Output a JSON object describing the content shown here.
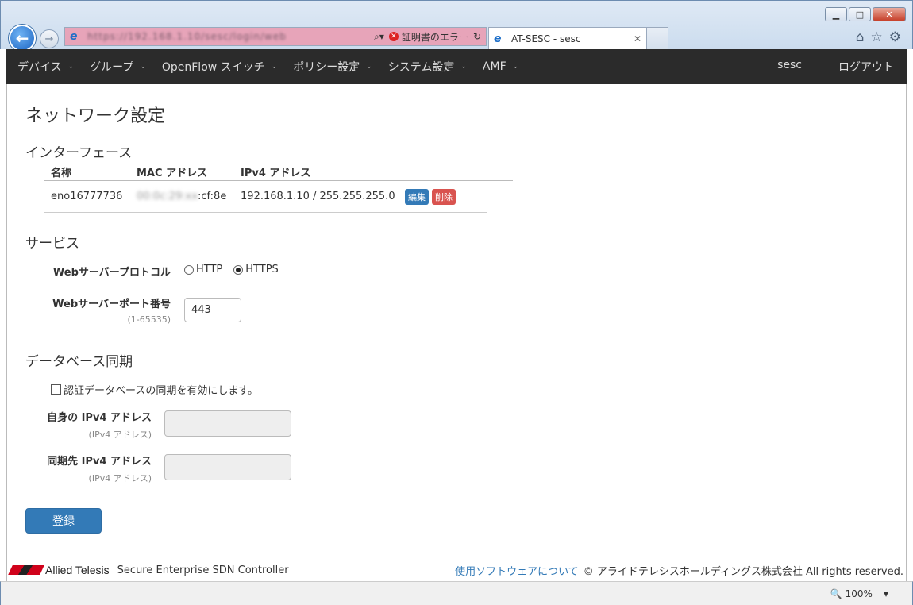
{
  "browser": {
    "address_url": "https://192.168.1.10/sesc/login/web",
    "cert_error": "証明書のエラー",
    "tab_title": "AT-SESC - sesc",
    "zoom": "100%"
  },
  "navbar": {
    "items": [
      {
        "label": "デバイス"
      },
      {
        "label": "グループ"
      },
      {
        "label": "OpenFlow スイッチ"
      },
      {
        "label": "ポリシー設定"
      },
      {
        "label": "システム設定"
      },
      {
        "label": "AMF"
      }
    ],
    "user": "sesc",
    "logout": "ログアウト"
  },
  "page": {
    "title": "ネットワーク設定",
    "interfaces": {
      "heading": "インターフェース",
      "columns": [
        "名称",
        "MAC アドレス",
        "IPv4 アドレス"
      ],
      "rows": [
        {
          "name": "eno16777736",
          "mac_hidden": "00:0c:29:xx",
          "mac_visible": ":cf:8e",
          "ipv4": "192.168.1.10 / 255.255.255.0",
          "edit": "編集",
          "delete": "削除"
        }
      ]
    },
    "services": {
      "heading": "サービス",
      "protocol_label": "Webサーバープロトコル",
      "options": [
        "HTTP",
        "HTTPS"
      ],
      "selected": "HTTPS",
      "port_label": "Webサーバーポート番号",
      "port_hint": "(1-65535)",
      "port_value": "443"
    },
    "db_sync": {
      "heading": "データベース同期",
      "enable_label": "認証データベースの同期を有効にします。",
      "self_label": "自身の IPv4 アドレス",
      "self_hint": "(IPv4 アドレス)",
      "peer_label": "同期先 IPv4 アドレス",
      "peer_hint": "(IPv4 アドレス)"
    },
    "submit": "登録"
  },
  "footer": {
    "brand": "Allied Telesis",
    "product": "Secure Enterprise SDN Controller",
    "link": "使用ソフトウェアについて",
    "copyright": "© アライドテレシスホールディングス株式会社 All rights reserved."
  }
}
